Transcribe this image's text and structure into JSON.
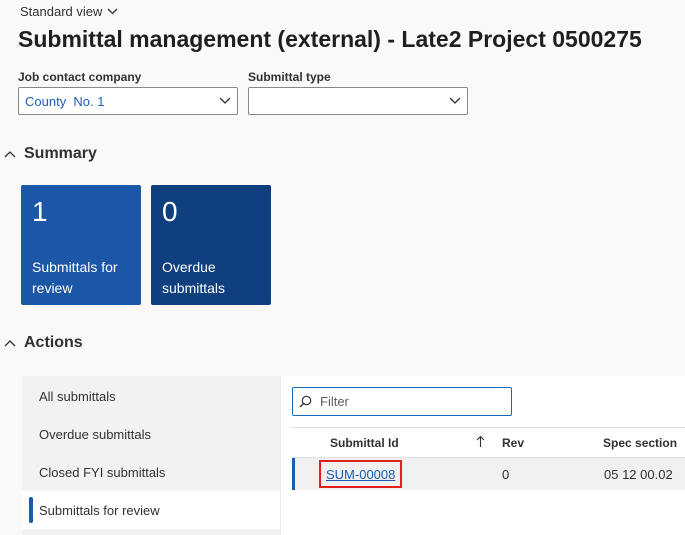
{
  "header": {
    "view_label": "Standard view",
    "title": "Submittal management (external) - Late2 Project 0500275"
  },
  "filters": {
    "job_contact_company": {
      "label": "Job contact company",
      "value": "County  No. 1"
    },
    "submittal_type": {
      "label": "Submittal type",
      "value": ""
    }
  },
  "summary": {
    "title": "Summary",
    "tiles": [
      {
        "count": "1",
        "label": "Submittals for review",
        "color": "#1c56a6"
      },
      {
        "count": "0",
        "label": "Overdue submittals",
        "color": "#0f3f7f"
      }
    ]
  },
  "actions": {
    "title": "Actions",
    "nav": [
      {
        "label": "All submittals"
      },
      {
        "label": "Overdue submittals"
      },
      {
        "label": "Closed FYI submittals"
      },
      {
        "label": "Submittals for review",
        "selected": true
      }
    ]
  },
  "grid": {
    "filter_placeholder": "Filter",
    "columns": [
      "Submittal Id",
      "Rev",
      "Spec section"
    ],
    "rows": [
      {
        "submittal_id": "SUM-00008",
        "rev": "0",
        "spec_section": "05 12 00.02"
      }
    ]
  },
  "colors": {
    "accent": "#1c5bb0",
    "highlight_box": "#e02020"
  }
}
